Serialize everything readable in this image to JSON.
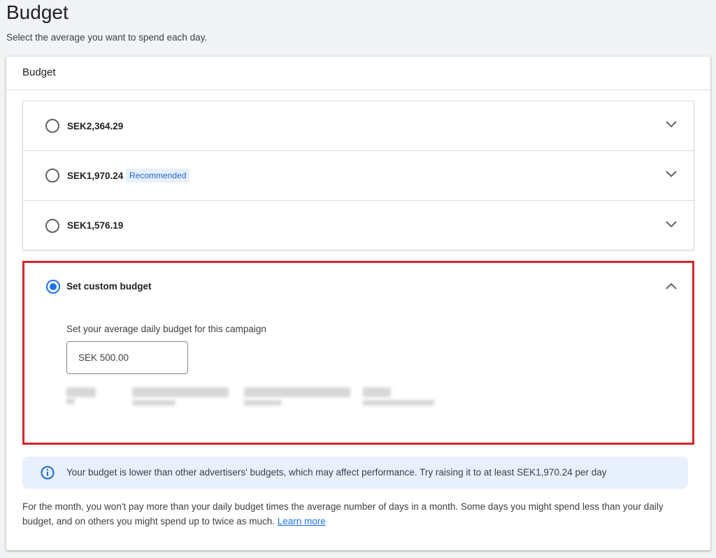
{
  "page": {
    "title": "Budget",
    "subtitle": "Select the average you want to spend each day."
  },
  "card": {
    "header": "Budget",
    "options": [
      {
        "label": "SEK2,364.29",
        "selected": false
      },
      {
        "label": "SEK1,970.24",
        "badge": "Recommended",
        "selected": false
      },
      {
        "label": "SEK1,576.19",
        "selected": false
      }
    ],
    "custom": {
      "label": "Set custom budget",
      "selected": true,
      "description": "Set your average daily budget for this campaign",
      "input_value": "SEK 500.00"
    },
    "info": {
      "text": "Your budget is lower than other advertisers' budgets, which may affect performance. Try raising it to at least SEK1,970.24 per day"
    },
    "footer": {
      "text": "For the month, you won't pay more than your daily budget times the average number of days in a month. Some days you might spend less than your daily budget, and on others you might spend up to twice as much.",
      "link": "Learn more"
    }
  },
  "colors": {
    "accent": "#1a73e8",
    "highlight_border": "#d3242c",
    "info_bg": "#e8f0fe"
  },
  "icons": {
    "expand": "chevron-down-icon",
    "collapse": "chevron-up-icon",
    "info": "info-icon"
  }
}
